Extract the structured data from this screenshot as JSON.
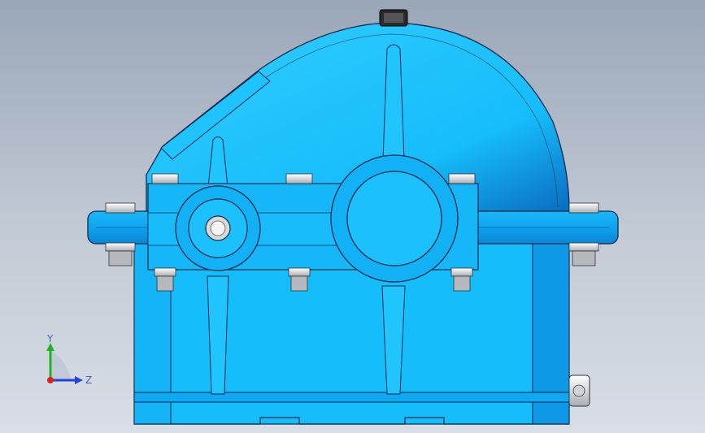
{
  "model": {
    "body_color": "#16bdfb",
    "shadow_color": "#0a78c8",
    "edge_color": "#0b2a4a",
    "bolt_color": "#e6e6e6"
  },
  "triad": {
    "y_label": "Y",
    "z_label": "Z",
    "x_color": "#e02020",
    "y_color": "#22b322",
    "z_color": "#2244dd"
  }
}
